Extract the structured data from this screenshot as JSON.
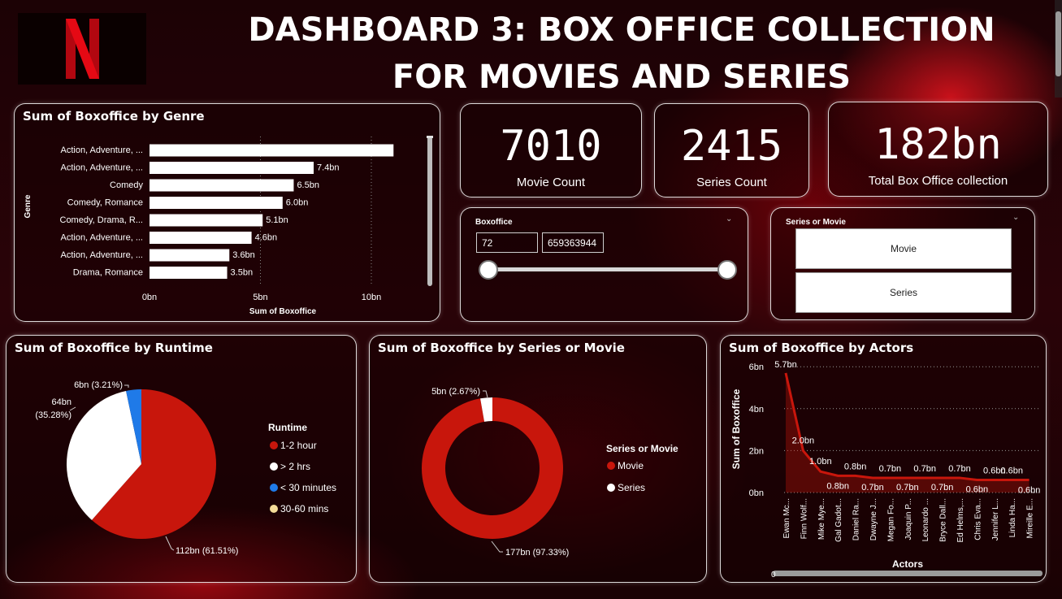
{
  "header": {
    "title": "DASHBOARD 3: BOX OFFICE COLLECTION FOR MOVIES AND SERIES"
  },
  "colors": {
    "red": "#c8160c",
    "white": "#ffffff",
    "blue": "#1f7ae8",
    "yellow": "#f4dc98"
  },
  "kpis": {
    "movie_count": {
      "value": "7010",
      "label": "Movie Count"
    },
    "series_count": {
      "value": "2415",
      "label": "Series Count"
    },
    "total_box_office": {
      "value": "182bn",
      "label": "Total Box Office collection"
    }
  },
  "boxoffice_slicer": {
    "label": "Boxoffice",
    "min": "72",
    "max": "659363944",
    "chevron": "chevron-down-icon"
  },
  "series_movie_slicer": {
    "label": "Series or Movie",
    "options": [
      "Movie",
      "Series"
    ],
    "chevron": "chevron-down-icon"
  },
  "charts": {
    "genre": {
      "title": "Sum of Boxoffice by Genre"
    },
    "runtime": {
      "title": "Sum of Boxoffice by Runtime"
    },
    "series_movie": {
      "title": "Sum of Boxoffice by Series or Movie"
    },
    "actors": {
      "title": "Sum of Boxoffice by Actors"
    }
  },
  "chart_data": [
    {
      "type": "bar",
      "orientation": "horizontal",
      "title": "Sum of Boxoffice by Genre",
      "xlabel": "Sum of Boxoffice",
      "ylabel": "Genre",
      "categories": [
        "Action, Adventure, ...",
        "Action, Adventure, ...",
        "Comedy",
        "Comedy, Romance",
        "Comedy, Drama, R...",
        "Action, Adventure, ...",
        "Action, Adventure, ...",
        "Drama, Romance"
      ],
      "values": [
        11.0,
        7.4,
        6.5,
        6.0,
        5.1,
        4.6,
        3.6,
        3.5
      ],
      "data_labels": [
        "",
        "7.4bn",
        "6.5bn",
        "6.0bn",
        "5.1bn",
        "4.6bn",
        "3.6bn",
        "3.5bn"
      ],
      "xticks": [
        "0bn",
        "5bn",
        "10bn"
      ],
      "xlim": [
        0,
        11.6
      ],
      "grid": true
    },
    {
      "type": "pie",
      "title": "Sum of Boxoffice by Runtime",
      "legend_title": "Runtime",
      "legend_position": "right",
      "categories": [
        "1-2 hour",
        "> 2 hrs",
        "< 30 minutes",
        "30-60 mins"
      ],
      "values": [
        112,
        64,
        6,
        0
      ],
      "percentages": [
        61.51,
        35.28,
        3.21,
        0
      ],
      "colors": [
        "#c8160c",
        "#ffffff",
        "#1f7ae8",
        "#f4dc98"
      ],
      "data_labels": [
        "112bn (61.51%)",
        "64bn\n(35.28%)",
        "6bn (3.21%)",
        ""
      ]
    },
    {
      "type": "pie",
      "subtype": "donut",
      "title": "Sum of Boxoffice by Series or Movie",
      "legend_title": "Series or Movie",
      "legend_position": "right",
      "categories": [
        "Movie",
        "Series"
      ],
      "values": [
        177,
        5
      ],
      "percentages": [
        97.33,
        2.67
      ],
      "colors": [
        "#c8160c",
        "#ffffff"
      ],
      "data_labels": [
        "177bn (97.33%)",
        "5bn (2.67%)"
      ]
    },
    {
      "type": "area",
      "title": "Sum of Boxoffice by Actors",
      "xlabel": "Actors",
      "ylabel": "Sum of Boxoffice",
      "categories": [
        "Ewan Mc...",
        "Finn Wolf...",
        "Mike Mye...",
        "Gal Gadot...",
        "Daniel Ra...",
        "Dwayne J...",
        "Megan Fo...",
        "Joaquin P...",
        "Leonardo ...",
        "Bryce Dall...",
        "Ed Helms,...",
        "Chris Eva...",
        "Jennifer L...",
        "Linda Ha...",
        "Mireille E..."
      ],
      "values": [
        5.7,
        2.0,
        1.0,
        0.8,
        0.8,
        0.7,
        0.7,
        0.7,
        0.7,
        0.7,
        0.7,
        0.6,
        0.6,
        0.6,
        0.6
      ],
      "data_labels": [
        "5.7bn",
        "2.0bn",
        "1.0bn",
        "0.8bn",
        "0.8bn",
        "0.7bn",
        "0.7bn",
        "0.7bn",
        "0.7bn",
        "0.7bn",
        "0.7bn",
        "0.6bn",
        "0.6bn",
        "0.6bn",
        "0.6bn"
      ],
      "yticks": [
        "0bn",
        "2bn",
        "4bn",
        "6bn"
      ],
      "ylim": [
        0,
        6
      ],
      "grid": true,
      "scroll_label": "0"
    }
  ]
}
